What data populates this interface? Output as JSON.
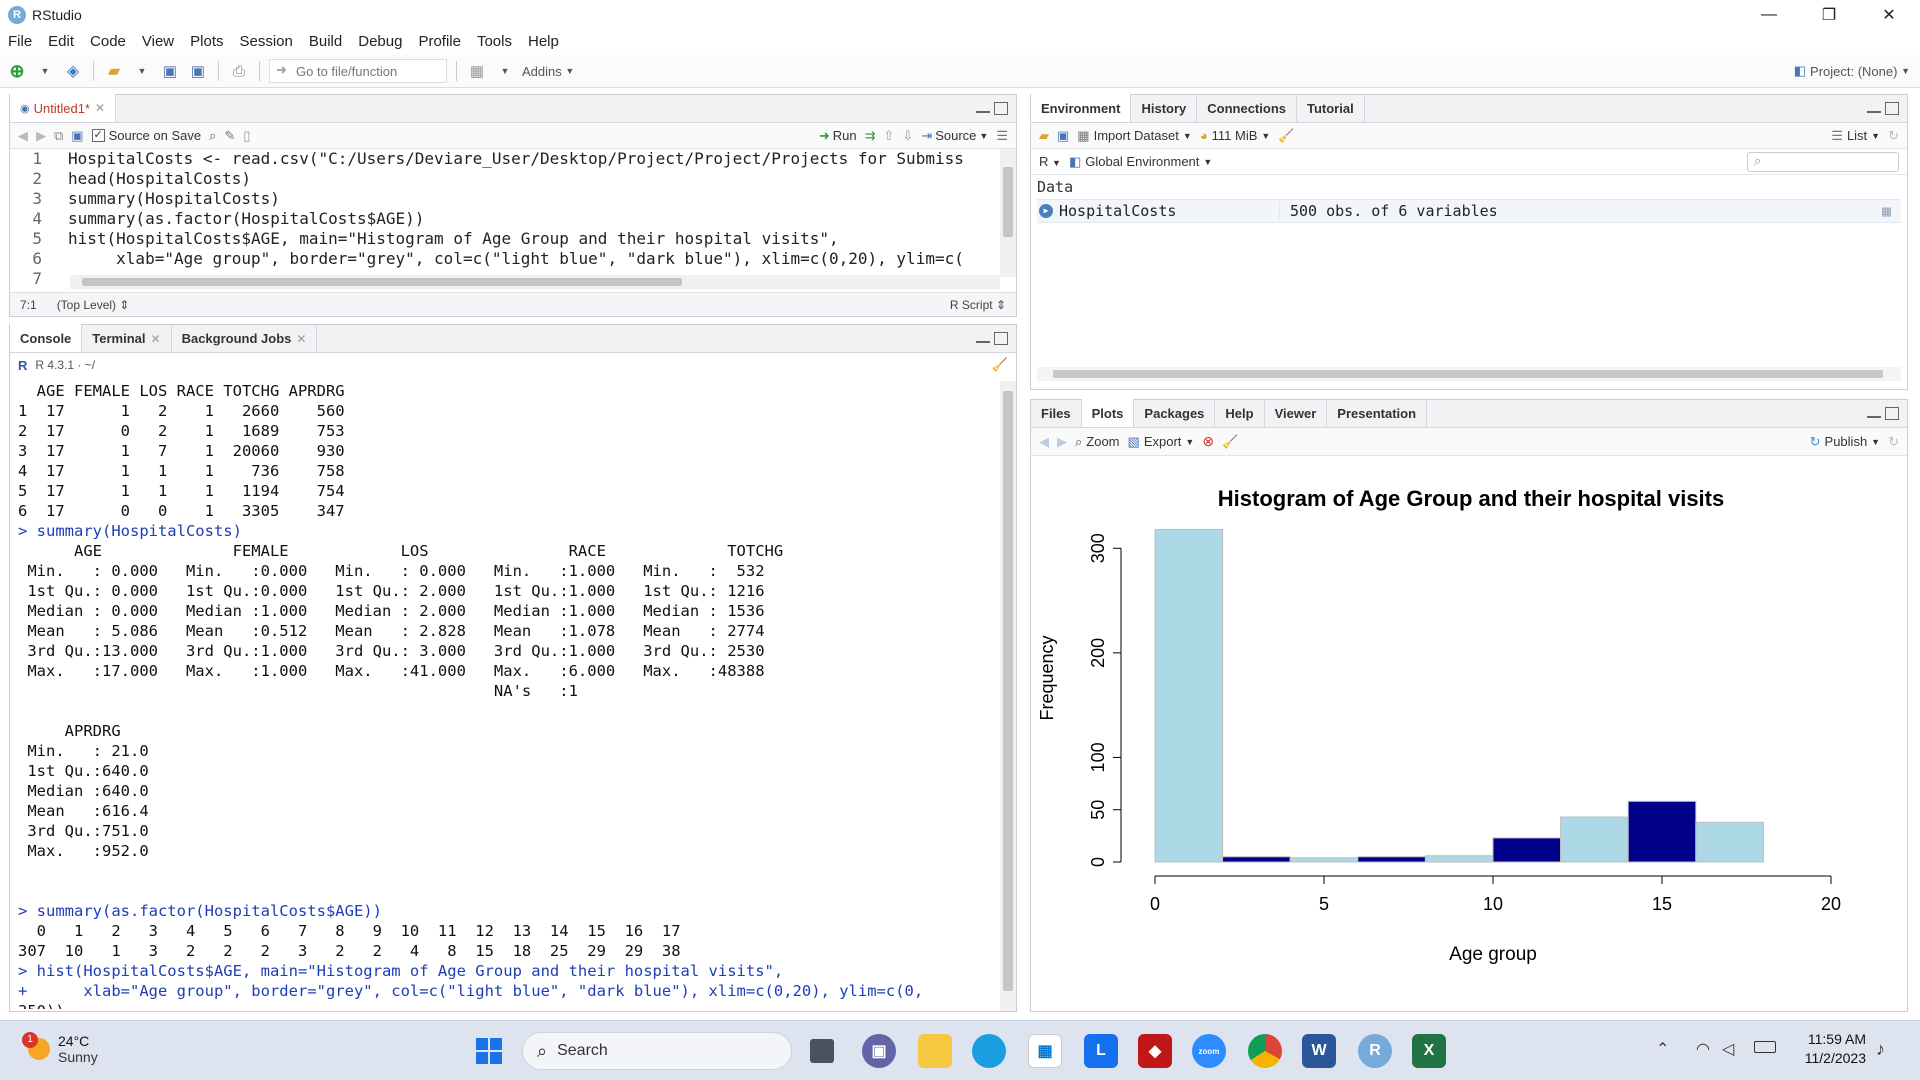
{
  "window": {
    "title": "RStudio",
    "app_icon": "R",
    "minimize": "—",
    "restore": "❐",
    "close": "✕"
  },
  "menu": [
    "File",
    "Edit",
    "Code",
    "View",
    "Plots",
    "Session",
    "Build",
    "Debug",
    "Profile",
    "Tools",
    "Help"
  ],
  "toolbar": {
    "goto_placeholder": "Go to file/function",
    "addins": "Addins",
    "project": "Project: (None)"
  },
  "editor": {
    "tab": "Untitled1*",
    "source_on_save": "Source on Save",
    "run": "Run",
    "source": "Source",
    "lines": [
      {
        "n": "1",
        "text": "HospitalCosts <- read.csv(\"C:/Users/Deviare_User/Desktop/Project/Project/Projects for Submiss"
      },
      {
        "n": "2",
        "text": "head(HospitalCosts)"
      },
      {
        "n": "3",
        "text": "summary(HospitalCosts)"
      },
      {
        "n": "4",
        "text": "summary(as.factor(HospitalCosts$AGE))"
      },
      {
        "n": "5",
        "text": "hist(HospitalCosts$AGE, main=\"Histogram of Age Group and their hospital visits\","
      },
      {
        "n": "6",
        "text": "     xlab=\"Age group\", border=\"grey\", col=c(\"light blue\", \"dark blue\"), xlim=c(0,20), ylim=c("
      },
      {
        "n": "7",
        "text": ""
      }
    ],
    "status_pos": "7:1",
    "status_scope": "(Top Level)",
    "status_type": "R Script"
  },
  "console": {
    "tabs": [
      "Console",
      "Terminal",
      "Background Jobs"
    ],
    "version": "R 4.3.1 · ~/",
    "lines": [
      "  AGE FEMALE LOS RACE TOTCHG APRDRG",
      "1  17      1   2    1   2660    560",
      "2  17      0   2    1   1689    753",
      "3  17      1   7    1  20060    930",
      "4  17      1   1    1    736    758",
      "5  17      1   1    1   1194    754",
      "6  17      0   0    1   3305    347",
      "> summary(HospitalCosts)",
      "      AGE              FEMALE            LOS               RACE             TOTCHG     ",
      " Min.   : 0.000   Min.   :0.000   Min.   : 0.000   Min.   :1.000   Min.   :  532  ",
      " 1st Qu.: 0.000   1st Qu.:0.000   1st Qu.: 2.000   1st Qu.:1.000   1st Qu.: 1216  ",
      " Median : 0.000   Median :1.000   Median : 2.000   Median :1.000   Median : 1536  ",
      " Mean   : 5.086   Mean   :0.512   Mean   : 2.828   Mean   :1.078   Mean   : 2774  ",
      " 3rd Qu.:13.000   3rd Qu.:1.000   3rd Qu.: 3.000   3rd Qu.:1.000   3rd Qu.: 2530  ",
      " Max.   :17.000   Max.   :1.000   Max.   :41.000   Max.   :6.000   Max.   :48388  ",
      "                                                   NA's   :1                       ",
      "",
      "     APRDRG     ",
      " Min.   : 21.0  ",
      " 1st Qu.:640.0  ",
      " Median :640.0  ",
      " Mean   :616.4  ",
      " 3rd Qu.:751.0  ",
      " Max.   :952.0  ",
      "",
      "",
      "> summary(as.factor(HospitalCosts$AGE))",
      "  0   1   2   3   4   5   6   7   8   9  10  11  12  13  14  15  16  17 ",
      "307  10   1   3   2   2   2   3   2   2   4   8  15  18  25  29  29  38 ",
      "> hist(HospitalCosts$AGE, main=\"Histogram of Age Group and their hospital visits\",",
      "+      xlab=\"Age group\", border=\"grey\", col=c(\"light blue\", \"dark blue\"), xlim=c(0,20), ylim=c(0,",
      "350))",
      "> "
    ]
  },
  "environment": {
    "tabs": [
      "Environment",
      "History",
      "Connections",
      "Tutorial"
    ],
    "import_dataset": "Import Dataset",
    "memory": "111 MiB",
    "view_mode": "List",
    "lang": "R",
    "scope": "Global Environment",
    "section": "Data",
    "rows": [
      {
        "name": "HospitalCosts",
        "value": "500 obs. of 6 variables"
      }
    ]
  },
  "plots": {
    "tabs": [
      "Files",
      "Plots",
      "Packages",
      "Help",
      "Viewer",
      "Presentation"
    ],
    "zoom": "Zoom",
    "export": "Export",
    "publish": "Publish"
  },
  "chart_data": {
    "type": "bar",
    "title": "Histogram of Age Group and their hospital visits",
    "xlabel": "Age group",
    "ylabel": "Frequency",
    "xlim": [
      0,
      20
    ],
    "ylim": [
      0,
      350
    ],
    "xticks": [
      "0",
      "5",
      "10",
      "15",
      "20"
    ],
    "yticks": [
      "0",
      "50",
      "100",
      "200",
      "300"
    ],
    "ytick_values": [
      0,
      50,
      100,
      200,
      300
    ],
    "xtick_values": [
      0,
      5,
      10,
      15,
      20
    ],
    "bins": [
      [
        0,
        2
      ],
      [
        2,
        4
      ],
      [
        4,
        6
      ],
      [
        6,
        8
      ],
      [
        8,
        10
      ],
      [
        10,
        12
      ],
      [
        12,
        14
      ],
      [
        14,
        16
      ],
      [
        16,
        18
      ]
    ],
    "values": [
      318,
      5,
      4,
      5,
      6,
      23,
      43,
      58,
      38
    ],
    "colors": [
      "#add8e6",
      "#00008b"
    ]
  },
  "taskbar": {
    "weather_temp": "24°C",
    "weather_desc": "Sunny",
    "weather_badge": "1",
    "search": "Search",
    "time": "11:59 AM",
    "date": "11/2/2023"
  }
}
